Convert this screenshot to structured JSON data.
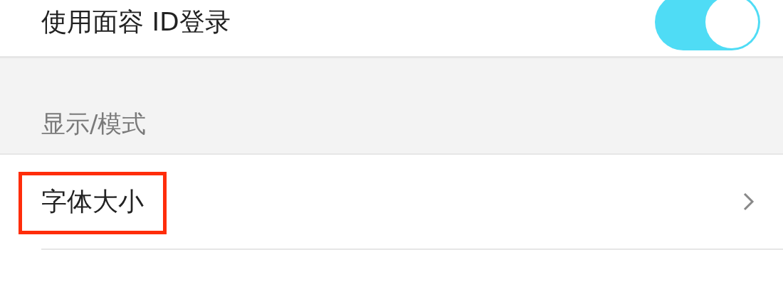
{
  "settings": [
    {
      "label": "使用面容 ID登录",
      "kind": "toggle",
      "on": true
    }
  ],
  "section": {
    "header": "显示/模式"
  },
  "items": [
    {
      "label": "字体大小",
      "kind": "link",
      "highlighted": true
    }
  ]
}
